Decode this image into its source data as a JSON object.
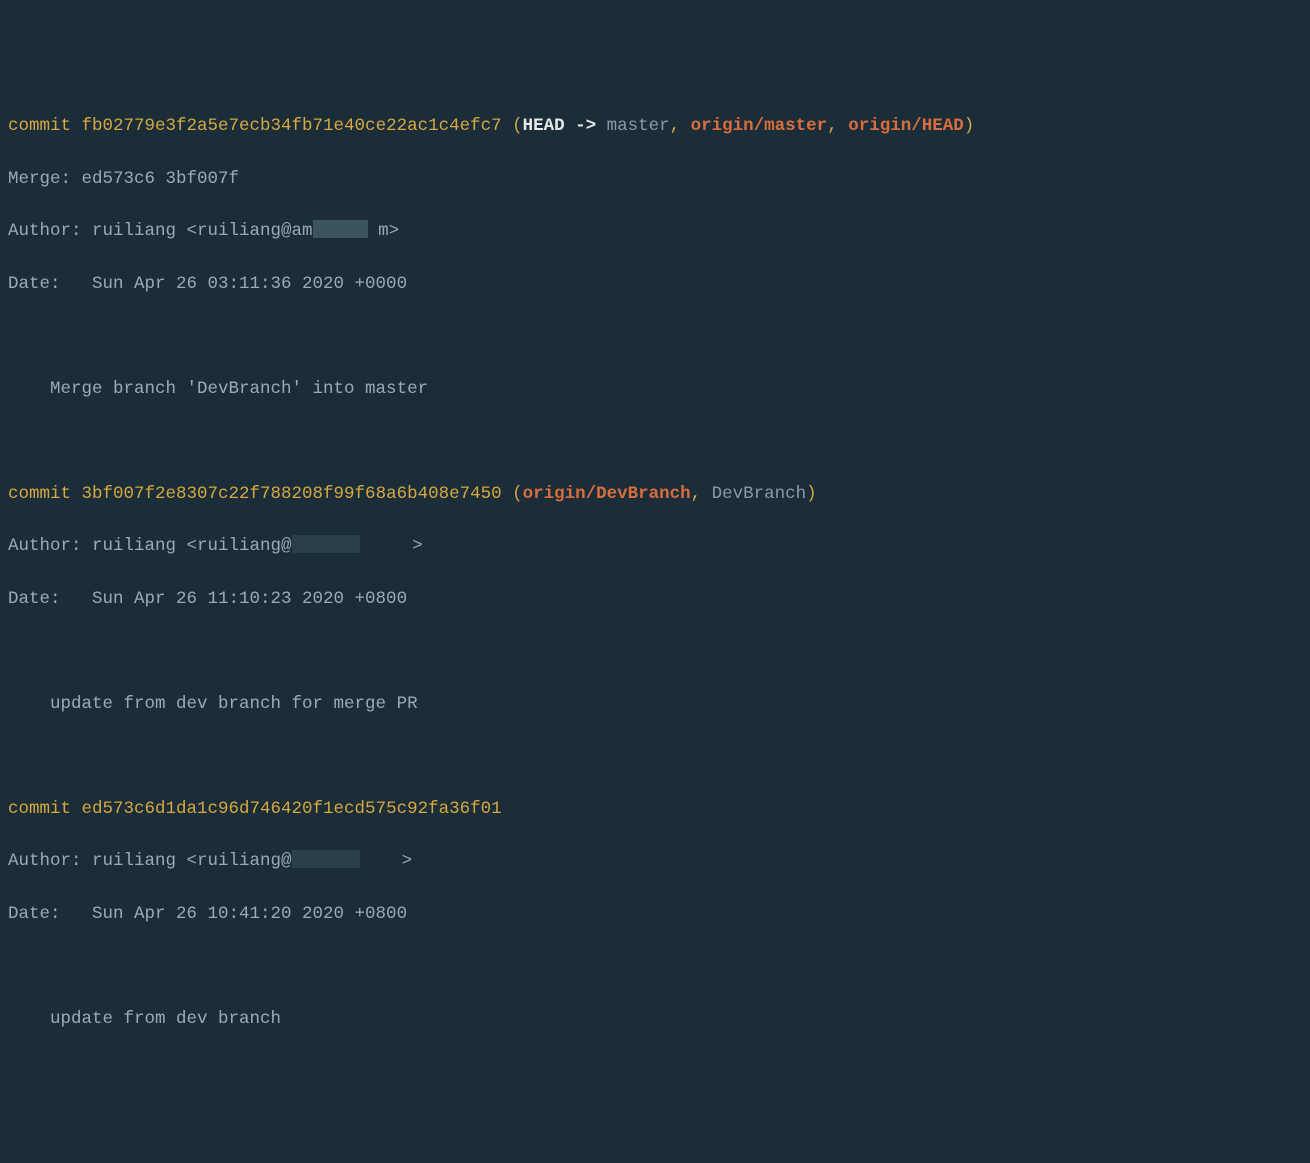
{
  "commits": [
    {
      "commitLabel": "commit ",
      "hash": "fb02779e3f2a5e7ecb34fb71e40ce22ac1c4efc7",
      "refs": {
        "open": " (",
        "head": "HEAD -> ",
        "master": "master",
        "sep1": ", ",
        "r1": "origin/master",
        "sep2": ", ",
        "r2": "origin/HEAD",
        "close": ")"
      },
      "mergeLine": "Merge: ed573c6 3bf007f",
      "authorPrefix": "Author: ruiliang <ruiliang@am",
      "authorSuffix": "m>",
      "dateLine": "Date:   Sun Apr 26 03:11:36 2020 +0000",
      "message": "    Merge branch 'DevBranch' into master"
    },
    {
      "commitLabel": "commit ",
      "hash": "3bf007f2e8307c22f788208f99f68a6b408e7450",
      "refs": {
        "open": " (",
        "r1": "origin/DevBranch",
        "sep1": ", ",
        "r2": "DevBranch",
        "close": ")"
      },
      "authorPrefix": "Author: ruiliang <ruiliang@",
      "authorSuffix": ">",
      "dateLine": "Date:   Sun Apr 26 11:10:23 2020 +0800",
      "message": "    update from dev branch for merge PR"
    },
    {
      "commitLabel": "commit ",
      "hash": "ed573c6d1da1c96d746420f1ecd575c92fa36f01",
      "authorPrefix": "Author: ruiliang <ruiliang@",
      "authorSuffix": ">",
      "dateLine": "Date:   Sun Apr 26 10:41:20 2020 +0800",
      "message": "    update from dev branch"
    }
  ]
}
